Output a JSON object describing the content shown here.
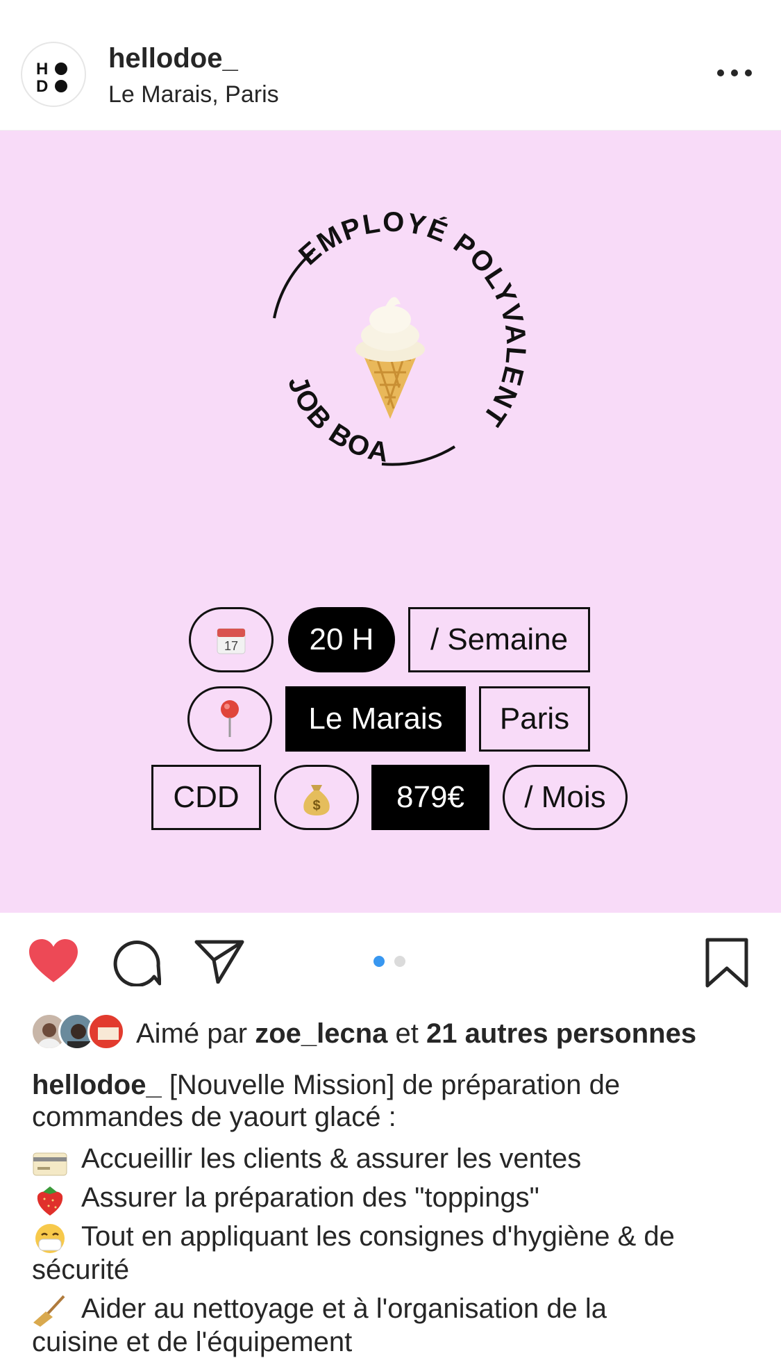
{
  "header": {
    "avatar_text": [
      "H",
      "D"
    ],
    "username": "hellodoe_",
    "location": "Le Marais, Paris"
  },
  "post": {
    "background": "#f8dbf8",
    "badge_top_text": "EMPLOYÉ POLYVALENT",
    "badge_bottom_text": "JOB BOARD",
    "tags": {
      "calendar_icon_label": "17",
      "hours": "20 H",
      "per_week": "/ Semaine",
      "district": "Le Marais",
      "city": "Paris",
      "contract": "CDD",
      "salary": "879€",
      "per_month": "/ Mois"
    }
  },
  "actions": {
    "carousel_dots": 2,
    "active_dot_color": "#3897f0",
    "like_color": "#ed4956"
  },
  "likes": {
    "prefix": "Aimé par",
    "user": "zoe_lecna",
    "middle": "et",
    "others": "21 autres personnes"
  },
  "caption": {
    "author": "hellodoe_",
    "text_line1": " [Nouvelle Mission] de préparation de",
    "text_line2": "commandes de yaourt glacé :",
    "bullets": [
      "Accueillir les clients & assurer les ventes",
      "Assurer la préparation des \"toppings\"",
      "Tout en appliquant les consignes d'hygiène & de",
      "sécurité",
      "Aider au nettoyage et à l'organisation de la",
      "cuisine et de l'équipement"
    ]
  }
}
